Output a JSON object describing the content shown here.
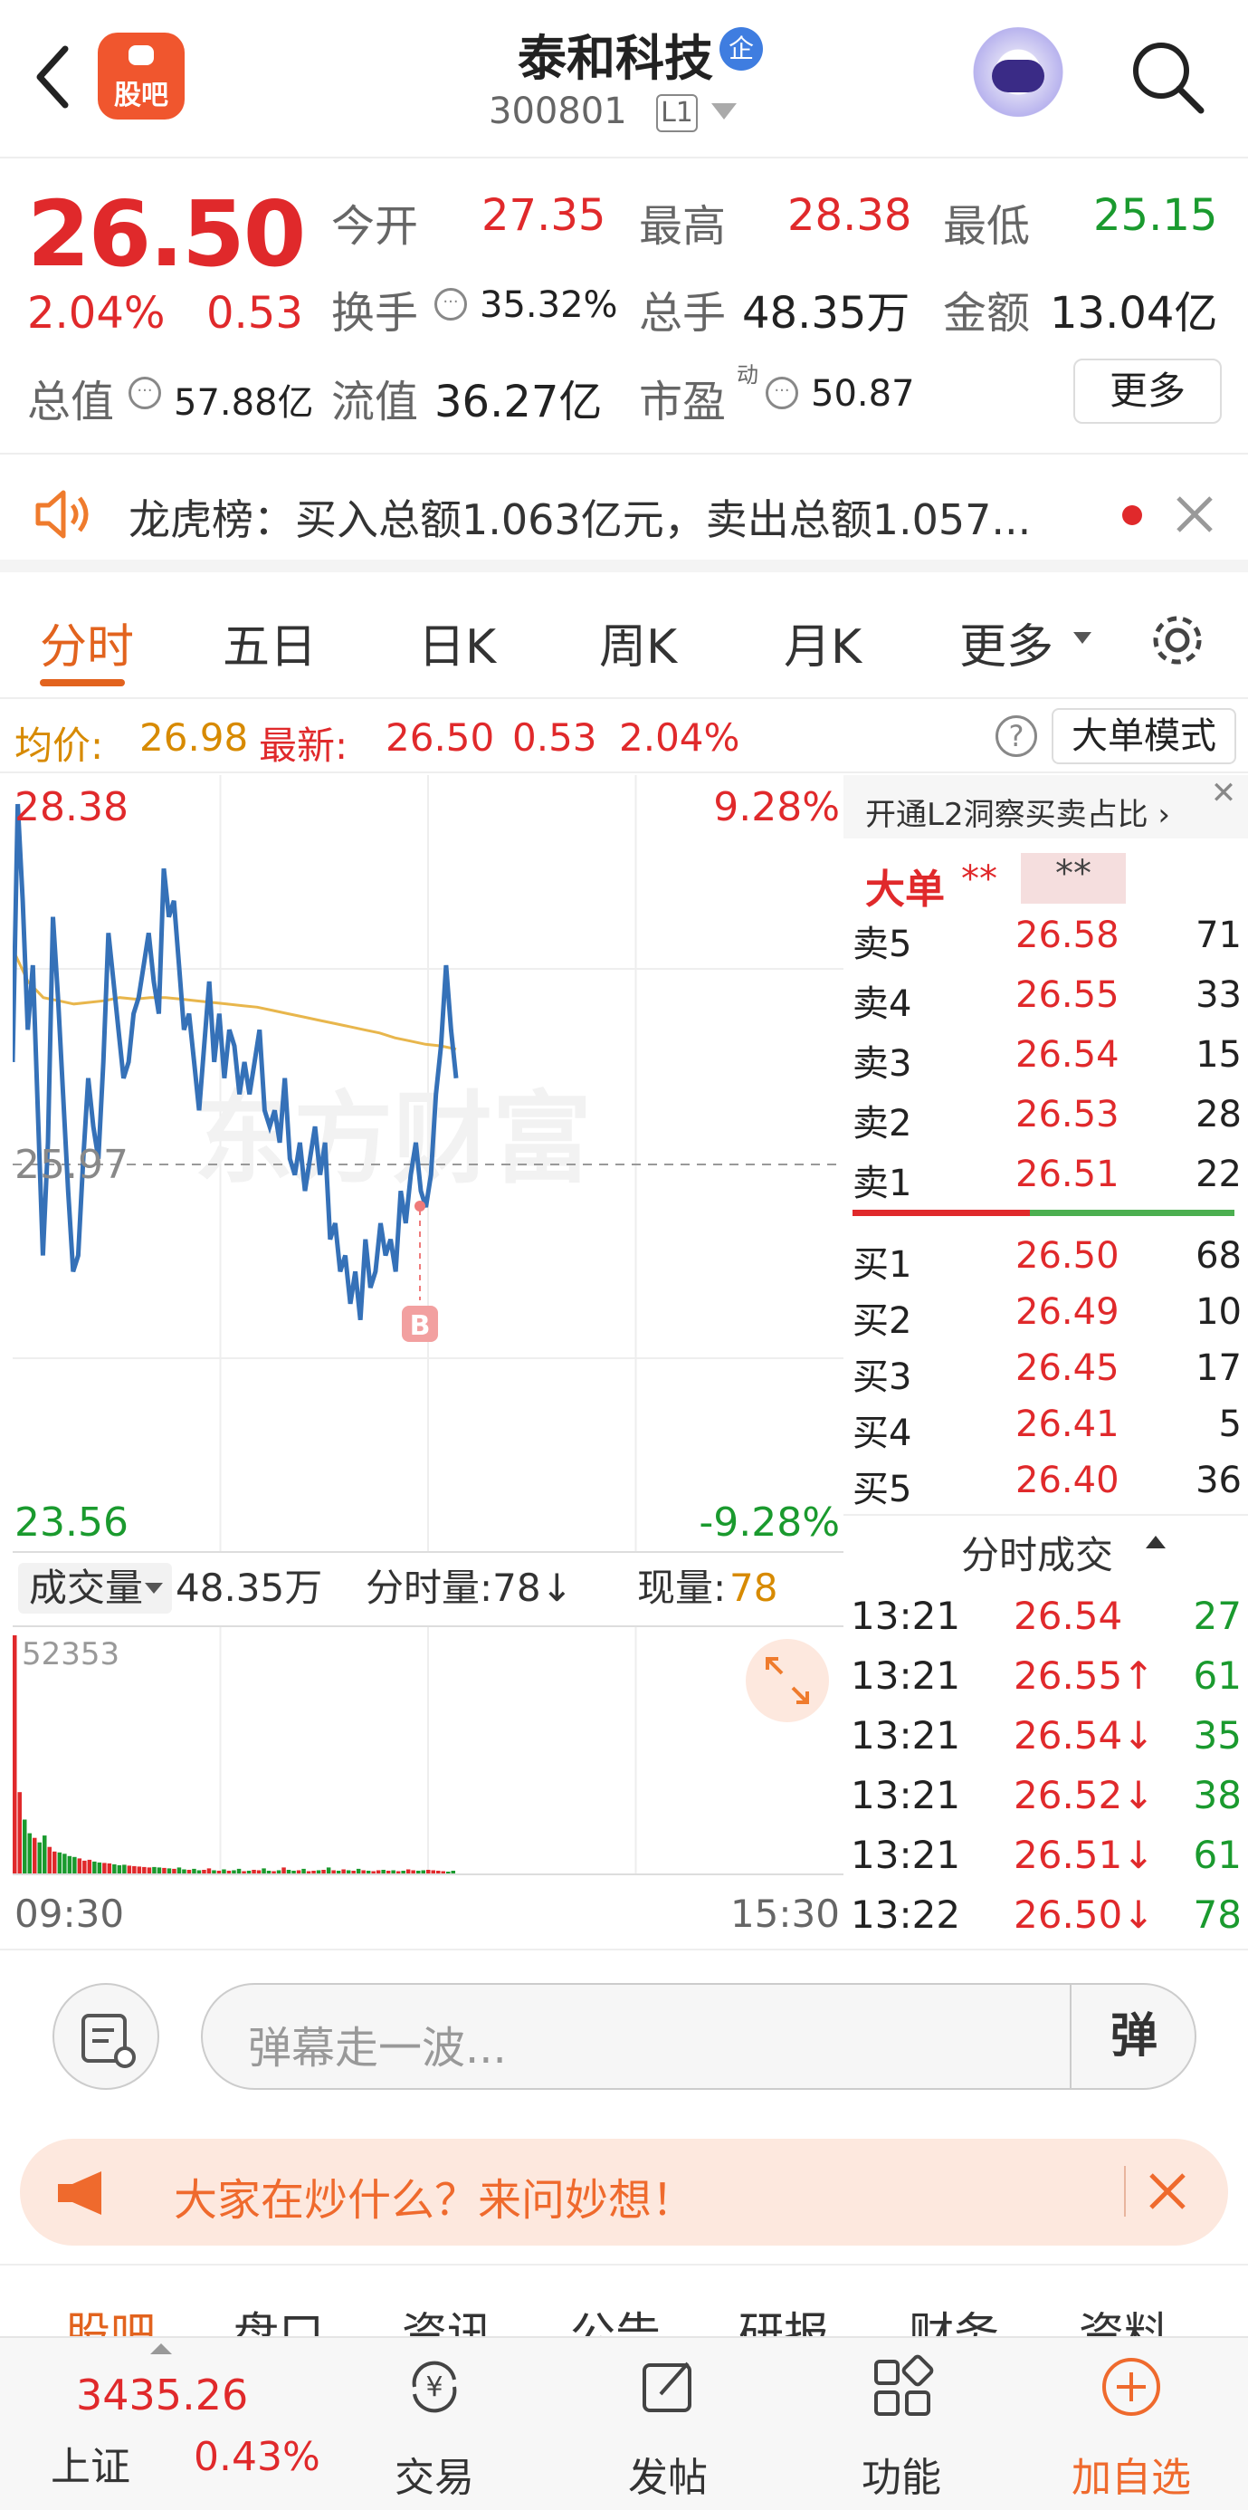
{
  "header": {
    "back_icon": "back-arrow-icon",
    "guba_label": "股吧",
    "title": "泰和科技",
    "badge": "企",
    "code": "300801",
    "level": "L1"
  },
  "quote": {
    "price": "26.50",
    "change_pct": "2.04%",
    "change": "0.53",
    "open_label": "今开",
    "open": "27.35",
    "high_label": "最高",
    "high": "28.38",
    "low_label": "最低",
    "low": "25.15",
    "turnover_label": "换手",
    "turnover": "35.32%",
    "volume_label": "总手",
    "volume": "48.35万",
    "amount_label": "金额",
    "amount": "13.04亿",
    "mktcap_label": "总值",
    "mktcap": "57.88亿",
    "float_label": "流值",
    "float": "36.27亿",
    "pe_label": "市盈",
    "pe_super": "动",
    "pe": "50.87",
    "more_label": "更多"
  },
  "banner": {
    "text": "龙虎榜：买入总额1.063亿元，卖出总额1.057..."
  },
  "tabs": [
    "分时",
    "五日",
    "日K",
    "周K",
    "月K",
    "更多"
  ],
  "info": {
    "avg_label": "均价:",
    "avg": "26.98",
    "latest_label": "最新:",
    "latest": "26.50",
    "chg": "0.53",
    "pct": "2.04%",
    "mode_label": "大单模式"
  },
  "chart_data": {
    "type": "line",
    "price_max": "28.38",
    "price_min": "23.56",
    "pct_max": "9.28%",
    "pct_min": "-9.28%",
    "prev_close": "25.97",
    "watermark": "东方财富",
    "marker": "B",
    "time_start": "09:30",
    "time_end": "15:30",
    "volume_label": "成交量",
    "volume_total": "48.35万",
    "minute_vol_label": "分时量:78↓",
    "cur_vol_label": "现量:",
    "cur_vol": "78",
    "vol_max": "52353",
    "ylim": [
      23.56,
      28.38
    ],
    "price": [
      26.6,
      28.2,
      27.6,
      26.8,
      27.2,
      26.3,
      25.4,
      26.1,
      27.5,
      27.0,
      26.4,
      25.8,
      25.3,
      25.4,
      26.0,
      26.5,
      26.2,
      26.0,
      26.6,
      27.4,
      27.1,
      26.8,
      26.5,
      26.6,
      26.9,
      27.0,
      27.2,
      27.4,
      27.1,
      26.9,
      27.8,
      27.5,
      27.6,
      27.2,
      26.8,
      26.9,
      26.6,
      26.3,
      26.7,
      27.1,
      26.6,
      26.9,
      26.5,
      26.8,
      26.7,
      26.4,
      26.6,
      26.4,
      26.6,
      26.8,
      26.3,
      26.2,
      26.3,
      26.1,
      26.5,
      26.0,
      25.9,
      26.1,
      25.8,
      26.0,
      26.2,
      25.9,
      26.1,
      25.5,
      25.6,
      25.3,
      25.4,
      25.1,
      25.3,
      25.0,
      25.5,
      25.2,
      25.3,
      25.6,
      25.4,
      25.5,
      25.3,
      25.8,
      25.6,
      25.9,
      26.1,
      25.8,
      25.7,
      25.9,
      26.4,
      26.7,
      27.2,
      26.8,
      26.5
    ],
    "avg": [
      27.3,
      27.1,
      27.0,
      26.98,
      26.96,
      26.97,
      26.98,
      27.0,
      26.99,
      27.0,
      27.0,
      26.99,
      26.98,
      26.97,
      26.96,
      26.95,
      26.94,
      26.92,
      26.9,
      26.88,
      26.86,
      26.84,
      26.82,
      26.8,
      26.78,
      26.75,
      26.73,
      26.71,
      26.7,
      26.68
    ],
    "volumes": [
      52353,
      18000,
      12000,
      9000,
      8000,
      7000,
      8500,
      6000,
      5000,
      4800,
      4500,
      4000,
      3800,
      3500,
      3000,
      3200,
      2800,
      2600,
      2500,
      2400,
      2200,
      2000,
      2100,
      1900,
      1800,
      1700,
      1600,
      1500,
      1600,
      1500,
      1400,
      1300,
      1200,
      1500,
      1100,
      1000,
      1200,
      900,
      1000,
      1300,
      900,
      800,
      1100,
      800,
      900,
      1200,
      700,
      800,
      1000,
      900,
      1300,
      800,
      700,
      900,
      1500,
      1000,
      800,
      900,
      1200,
      700,
      800,
      900,
      1000,
      1500,
      900,
      800,
      1100,
      900,
      800,
      1200,
      900,
      800,
      700,
      900,
      1000,
      800,
      900,
      700,
      800,
      1100,
      900,
      800,
      900,
      1000,
      900,
      800,
      700,
      600,
      800
    ]
  },
  "orderbook": {
    "l2_label": "开通L2洞察买卖占比 ›",
    "big_label": "大单",
    "stars1": "**",
    "stars2": "**",
    "sells": [
      {
        "l": "卖5",
        "p": "26.58",
        "v": "71"
      },
      {
        "l": "卖4",
        "p": "26.55",
        "v": "33"
      },
      {
        "l": "卖3",
        "p": "26.54",
        "v": "15"
      },
      {
        "l": "卖2",
        "p": "26.53",
        "v": "28"
      },
      {
        "l": "卖1",
        "p": "26.51",
        "v": "22"
      }
    ],
    "buys": [
      {
        "l": "买1",
        "p": "26.50",
        "v": "68"
      },
      {
        "l": "买2",
        "p": "26.49",
        "v": "10"
      },
      {
        "l": "买3",
        "p": "26.45",
        "v": "17"
      },
      {
        "l": "买4",
        "p": "26.41",
        "v": "5"
      },
      {
        "l": "买5",
        "p": "26.40",
        "v": "36"
      }
    ],
    "ticks_label": "分时成交",
    "ticks": [
      {
        "t": "13:21",
        "p": "26.54",
        "v": "27"
      },
      {
        "t": "13:21",
        "p": "26.55↑",
        "v": "61"
      },
      {
        "t": "13:21",
        "p": "26.54↓",
        "v": "35"
      },
      {
        "t": "13:21",
        "p": "26.52↓",
        "v": "38"
      },
      {
        "t": "13:21",
        "p": "26.51↓",
        "v": "61"
      },
      {
        "t": "13:22",
        "p": "26.50↓",
        "v": "78"
      }
    ]
  },
  "danmaku": {
    "placeholder": "弹幕走一波...",
    "send": "弹"
  },
  "ask": {
    "text": "大家在炒什么？来问妙想！"
  },
  "subtabs": [
    "股吧",
    "盘口",
    "资讯",
    "公告",
    "研报",
    "财务",
    "资料"
  ],
  "nav": {
    "index_value": "3435.26",
    "index_name": "上证",
    "index_pct": "0.43%",
    "items": [
      "交易",
      "发帖",
      "功能",
      "加自选"
    ]
  }
}
